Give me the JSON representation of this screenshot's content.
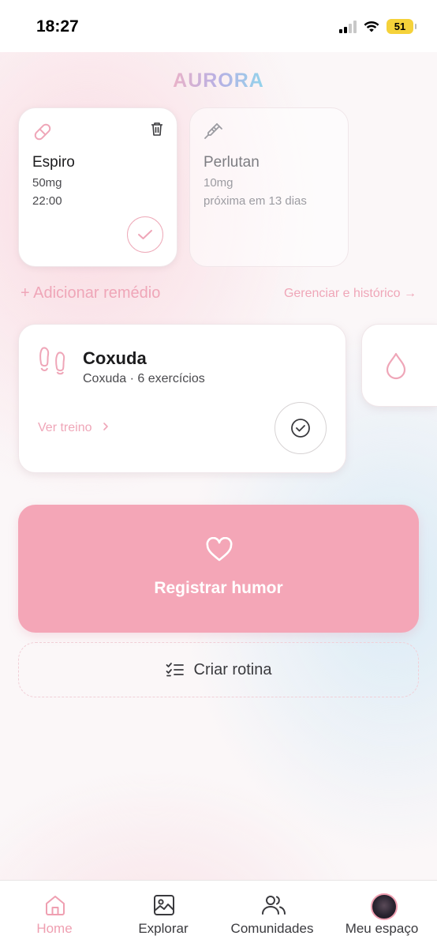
{
  "status_bar": {
    "time": "18:27",
    "battery": "51"
  },
  "app": {
    "logo": "AURORA"
  },
  "medications": [
    {
      "name": "Espiro",
      "dose": "50mg",
      "detail": "22:00",
      "icon": "pill-icon",
      "state": "active"
    },
    {
      "name": "Perlutan",
      "dose": "10mg",
      "detail": "próxima em 13 dias",
      "icon": "syringe-icon",
      "state": "inactive"
    }
  ],
  "medication_actions": {
    "add": "+ Adicionar remédio",
    "manage": "Gerenciar e histórico →"
  },
  "workout": {
    "title": "Coxuda",
    "subtitle": "Coxuda · 6 exercícios",
    "link": "Ver treino",
    "icon": "footprints-icon"
  },
  "water": {
    "icon": "droplet-icon"
  },
  "mood": {
    "label": "Registrar humor",
    "icon": "heart-icon"
  },
  "routine": {
    "label": "Criar rotina",
    "icon": "checklist-icon"
  },
  "tabs": [
    {
      "label": "Home",
      "icon": "home-icon",
      "active": true
    },
    {
      "label": "Explorar",
      "icon": "image-icon",
      "active": false
    },
    {
      "label": "Comunidades",
      "icon": "users-icon",
      "active": false
    },
    {
      "label": "Meu espaço",
      "icon": "avatar",
      "active": false
    }
  ],
  "colors": {
    "accent": "#f4a6b7",
    "accent_text": "#efa6b8",
    "background": "#fbf7f8"
  }
}
